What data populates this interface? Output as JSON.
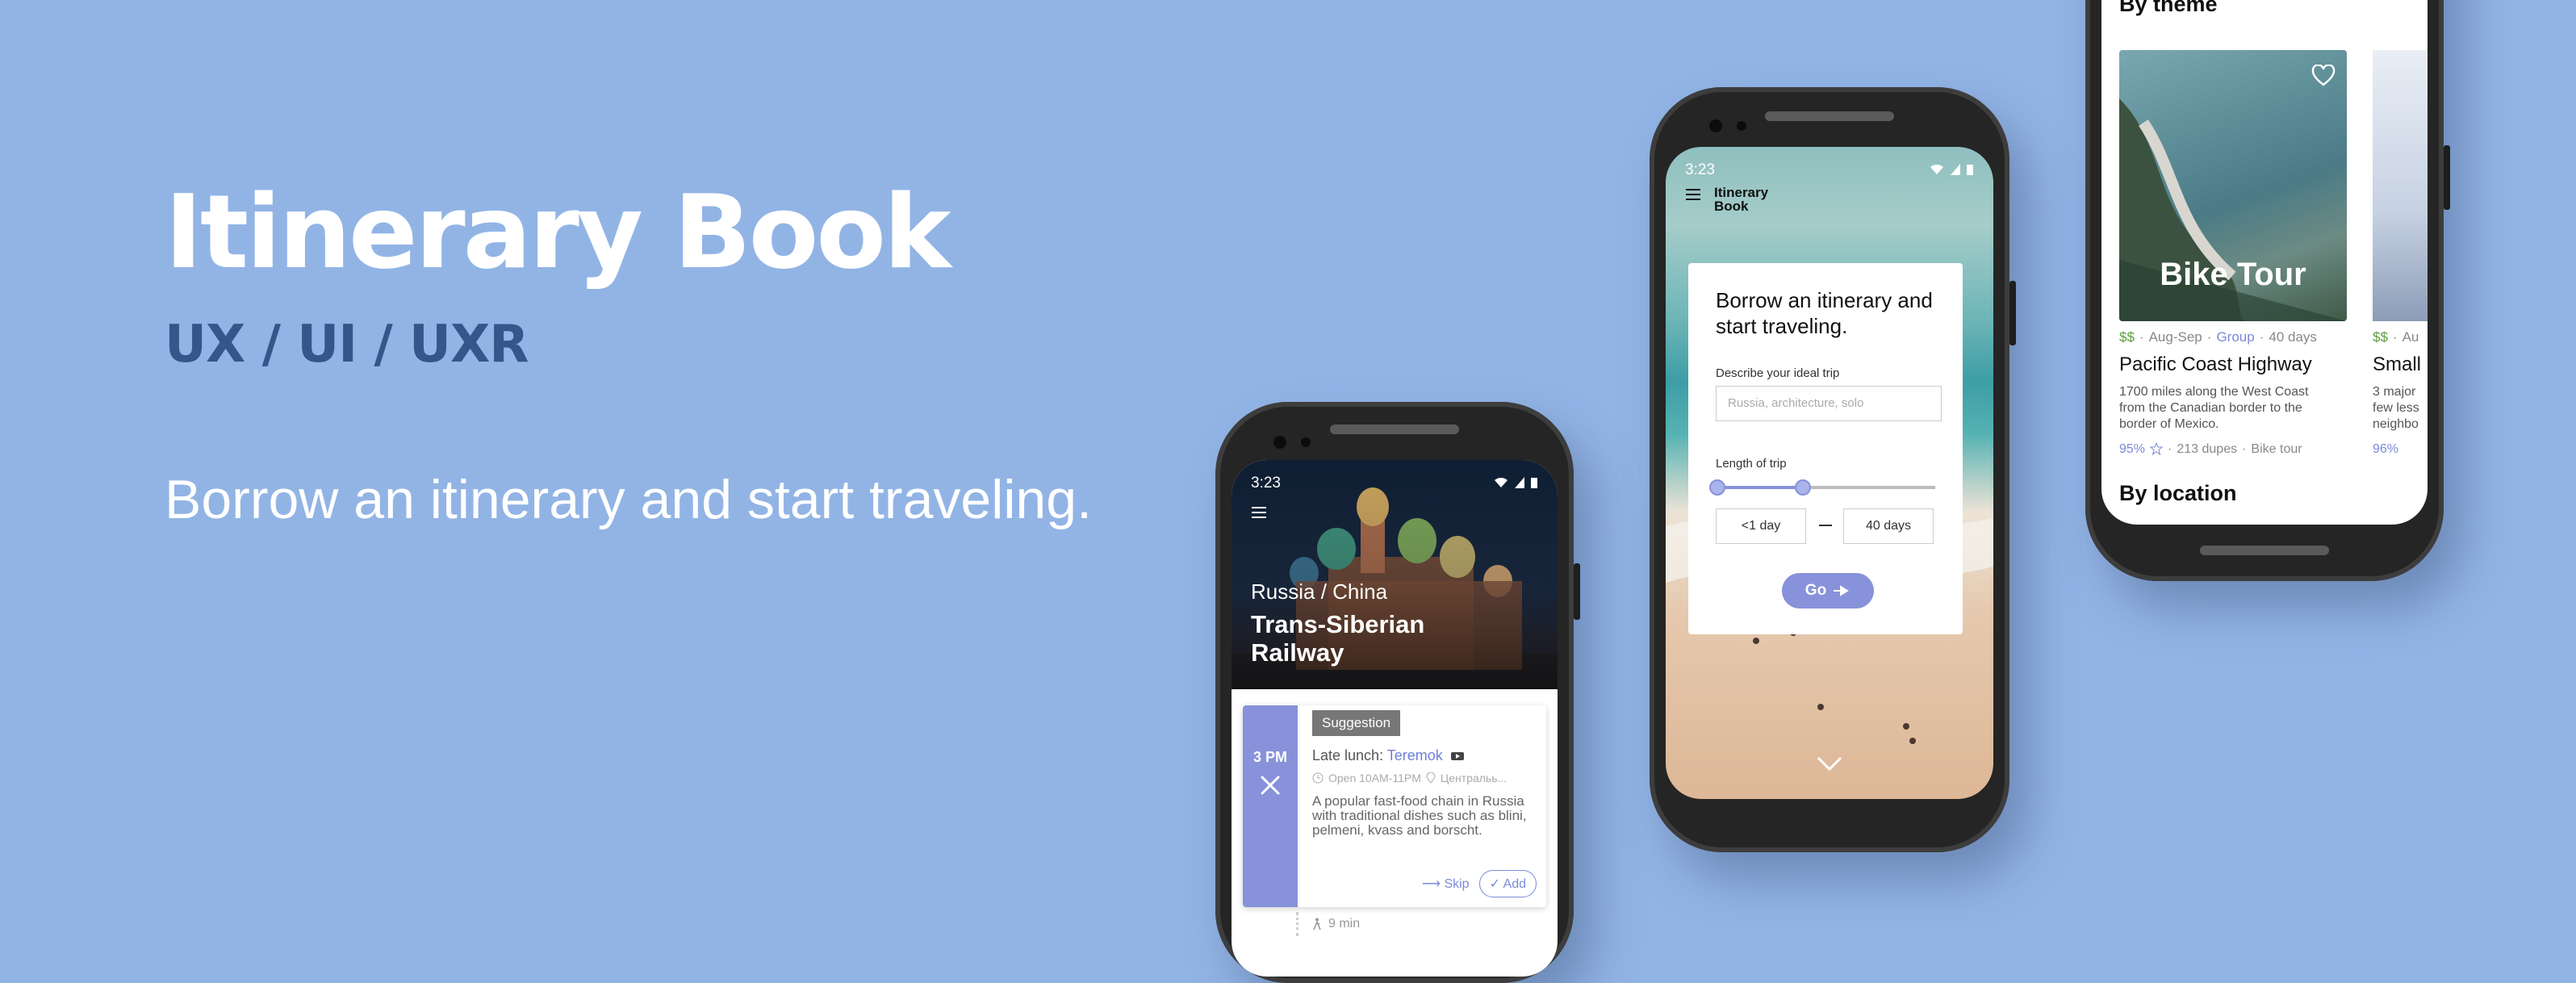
{
  "hero": {
    "title": "Itinerary Book",
    "subtitle": "UX / UI / UXR",
    "tagline": "Borrow an itinerary and start traveling."
  },
  "colors": {
    "background": "#92b4e5",
    "accent": "#8792da",
    "subtitle": "#35568a"
  },
  "phone_detail": {
    "status_time": "3:23",
    "hero_subtitle": "Russia / China",
    "hero_title": "Trans-Siberian Railway",
    "card": {
      "time": "3 PM",
      "badge": "Suggestion",
      "lunch_prefix": "Late lunch:",
      "lunch_place": "Teremok",
      "hours": "Open 10AM-11PM",
      "location": "Центральь...",
      "description": "A popular fast-food chain in Russia with traditional dishes such as blini, pelmeni, kvass and borscht.",
      "skip_label": "Skip",
      "add_label": "Add"
    },
    "walk_time": "9 min"
  },
  "phone_search": {
    "status_time": "3:23",
    "logo_line1": "Itinerary",
    "logo_line2": "Book",
    "form_title": "Borrow an itinerary and start traveling.",
    "describe_label": "Describe your ideal trip",
    "describe_placeholder": "Russia, architecture, solo",
    "length_label": "Length of trip",
    "min_value": "<1 day",
    "max_value": "40 days",
    "go_label": "Go"
  },
  "phone_browse": {
    "section_theme": "By theme",
    "section_location": "By location",
    "tours": [
      {
        "image_label": "Bike Tour",
        "price": "$$",
        "season": "Aug-Sep",
        "type": "Group",
        "duration": "40 days",
        "title": "Pacific Coast Highway",
        "description": "1700 miles along the West Coast from the Canadian border to the border of Mexico.",
        "rating": "95%",
        "dupes": "213 dupes",
        "tag": "Bike tour"
      },
      {
        "price": "$$",
        "season": "Au",
        "title": "Small",
        "description": "3 major few less neighbo",
        "rating": "96%"
      }
    ]
  }
}
